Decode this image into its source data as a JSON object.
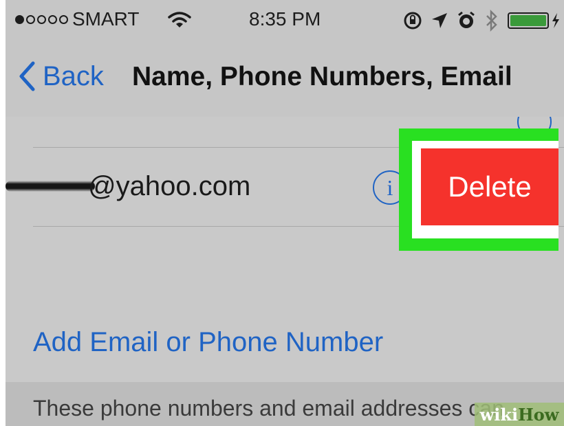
{
  "status_bar": {
    "carrier": "SMART",
    "signal_bars_filled": 1,
    "signal_bars_total": 5,
    "time": "8:35 PM",
    "battery_color": "#3a9a3a"
  },
  "nav": {
    "back_label": "Back",
    "title": "Name, Phone Numbers, Email"
  },
  "email_row": {
    "email_text": "@yahoo.com",
    "info_label": "i",
    "delete_label": "Delete",
    "delete_color": "#f5322c"
  },
  "add_label": "Add Email or Phone Number",
  "footer_text": "These phone numbers and email addresses can",
  "watermark": {
    "part1": "wiki",
    "part2": "How"
  },
  "highlight_color": "#29e021",
  "accent_color": "#1f63c4"
}
